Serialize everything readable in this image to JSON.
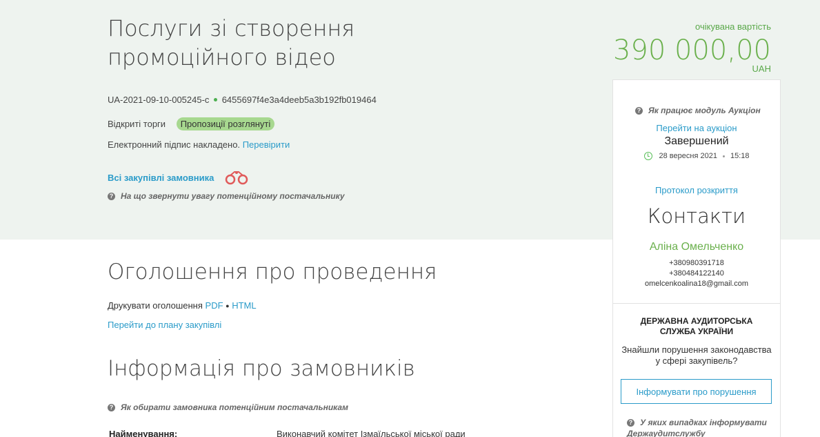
{
  "tender": {
    "title": "Послуги зі створення промоційного відео",
    "id": "UA-2021-09-10-005245-c",
    "hash": "6455697f4e3a4deeb5a3b192fb019464",
    "procedure": "Відкриті торги",
    "status_badge": "Пропозиції розглянуті",
    "signature_text": "Електронний підпис накладено.",
    "verify_link": "Перевірити",
    "all_purchases_link": "Всі закупівлі замовника",
    "hint_supplier": "На що звернути увагу потенційному постачальнику"
  },
  "price": {
    "label": "очікувана вартість",
    "amount": "390 000,00",
    "currency": "UAH"
  },
  "announcement": {
    "heading": "Оголошення про проведення",
    "print_label": "Друкувати оголошення",
    "pdf": "PDF",
    "bullet": "●",
    "html": "HTML",
    "plan_link": "Перейти до плану закупівлі"
  },
  "customers": {
    "heading": "Інформація про замовників",
    "hint": "Як обирати замовника потенційним постачальникам",
    "name_label": "Найменування:",
    "name_value": "Виконавчий комітет Ізмаїльської міської ради"
  },
  "sidebar": {
    "auction_hint": "Як працює модуль Аукціон",
    "auction_link": "Перейти на аукціон",
    "auction_status": "Завершений",
    "auction_date": "28 вересня 2021",
    "auction_time": "15:18",
    "protocol_link": "Протокол розкриття",
    "contacts_title": "Контакти",
    "contact_name": "Аліна Омельченко",
    "phone1": "+380980391718",
    "phone2": "+380484122140",
    "email": "omelcenkoalina18@gmail.com",
    "audit_title": "ДЕРЖАВНА АУДИТОРСЬКА СЛУЖБА УКРАЇНИ",
    "audit_text": "Знайшли порушення законодавства у сфері закупівель?",
    "report_button": "Інформувати про порушення",
    "audit_hint": "У яких випадках інформувати Держаудитслужбу"
  },
  "icons": {
    "question": "?",
    "binoculars": "binoculars-icon",
    "clock": "clock-icon"
  },
  "colors": {
    "link": "#2a9bc9",
    "price_green": "#6ab04c",
    "badge_green": "#a7d88f",
    "hero_bg": "#eef3ef"
  }
}
